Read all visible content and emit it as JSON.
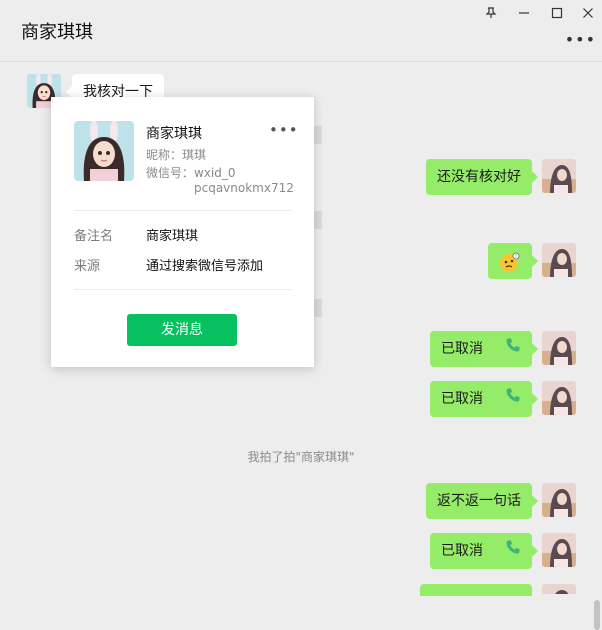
{
  "window": {
    "title": "商家琪琪",
    "pin_icon": "pin-icon",
    "minimize_icon": "minimize-icon",
    "maximize_icon": "maximize-icon",
    "close_icon": "close-icon",
    "more_icon": "more-icon"
  },
  "messages": {
    "m1": {
      "text": "我核对一下",
      "side": "them"
    },
    "m2": {
      "text": "还没有核对好",
      "side": "me"
    },
    "m3": {
      "emoji": "thinking-emoji-icon",
      "side": "me"
    },
    "m4": {
      "text": "已取消",
      "side": "me",
      "icon": "phone-icon"
    },
    "m5": {
      "text": "已取消",
      "side": "me",
      "icon": "phone-icon"
    },
    "system": {
      "text": "我拍了拍\"商家琪琪\""
    },
    "m6": {
      "text": "返不返一句话",
      "side": "me"
    },
    "m7": {
      "text": "已取消",
      "side": "me",
      "icon": "phone-icon"
    }
  },
  "profile_card": {
    "name": "商家琪琪",
    "nickname": "昵称：琪琪",
    "wxid_label": "微信号：wxid_0",
    "wxid_rest": "pcqavnokmx712",
    "remark_label": "备注名",
    "remark_value": "商家琪琪",
    "source_label": "来源",
    "source_value": "通过搜索微信号添加",
    "send_button": "发消息",
    "more_icon": "more-icon"
  },
  "colors": {
    "my_bubble": "#95ec69",
    "their_bubble": "#ffffff",
    "accent_button": "#07c160",
    "background": "#ededed"
  }
}
